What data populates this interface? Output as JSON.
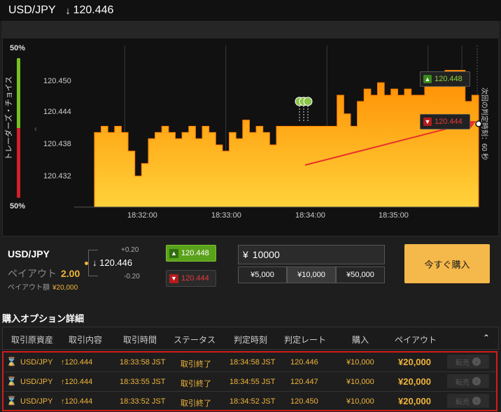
{
  "header": {
    "pair": "USD/JPY",
    "direction_icon": "↓",
    "price": "120.446"
  },
  "gauge": {
    "top_label": "50%",
    "bottom_label": "50%",
    "caption": "トレーダーズ・チョイス",
    "up_fraction": 0.5,
    "up_color": "#74c020",
    "down_color": "#d0202a"
  },
  "chart": {
    "y_ticks": [
      "120.450",
      "120.444",
      "120.438",
      "120.432"
    ],
    "x_ticks": [
      "18:32:00",
      "18:33:00",
      "18:34:00",
      "18:35:00"
    ],
    "up_price": "120.448",
    "down_price": "120.444",
    "side_label": "次回の判定時刻：60 秒"
  },
  "chart_data": {
    "type": "area",
    "ylim": [
      120.428,
      120.454
    ],
    "xlim": [
      "18:31:30",
      "18:35:30"
    ],
    "y_ticks": [
      120.45,
      120.444,
      120.438,
      120.432
    ],
    "x_ticks": [
      "18:32:00",
      "18:33:00",
      "18:34:00",
      "18:35:00"
    ],
    "x_seconds_from_start": [
      0,
      4,
      8,
      12,
      16,
      20,
      24,
      28,
      32,
      36,
      40,
      44,
      48,
      52,
      56,
      60,
      64,
      68,
      72,
      76,
      80,
      84,
      88,
      92,
      96,
      100,
      104,
      108,
      112,
      116,
      120,
      124,
      128,
      132,
      136,
      140,
      144,
      148,
      152,
      156,
      160,
      164,
      168,
      172,
      176,
      180,
      184,
      188,
      192,
      196,
      200,
      204,
      208,
      212,
      216,
      220,
      224,
      228
    ],
    "values": [
      120.44,
      120.441,
      120.44,
      120.441,
      120.44,
      120.437,
      120.433,
      120.435,
      120.439,
      120.44,
      120.441,
      120.44,
      120.439,
      120.44,
      120.441,
      120.439,
      120.441,
      120.44,
      120.438,
      120.437,
      120.44,
      120.439,
      120.442,
      120.44,
      120.441,
      120.44,
      120.438,
      120.441,
      120.441,
      120.441,
      120.441,
      120.441,
      120.441,
      120.441,
      120.441,
      120.441,
      120.446,
      120.443,
      120.441,
      120.445,
      120.447,
      120.446,
      120.448,
      120.446,
      120.447,
      120.446,
      120.447,
      120.446,
      120.446,
      120.448,
      120.448,
      120.448,
      120.45,
      120.45,
      120.45,
      120.445,
      120.446,
      120.446
    ],
    "series_color": "#ff9a00",
    "grid": true,
    "annotations": [
      "trend-arrow",
      "marker-pins"
    ]
  },
  "panel": {
    "pair": "USD/JPY",
    "payout_label": "ペイアウト",
    "payout_mult": "2.00",
    "payout_amount_label": "ペイアウト額",
    "payout_amount": "¥20,000",
    "plus": "+0.20",
    "minus": "-0.20",
    "current": "120.446",
    "up_price": "120.448",
    "down_price": "120.444",
    "amount_symbol": "¥",
    "amount_value": "10000",
    "chips": [
      "¥5,000",
      "¥10,000",
      "¥50,000"
    ],
    "buy_label": "今すぐ購入"
  },
  "details": {
    "title": "購入オプション詳細",
    "columns": [
      "取引原資産",
      "取引内容",
      "取引時間",
      "ステータス",
      "判定時刻",
      "判定レート",
      "購入",
      "ペイアウト"
    ],
    "rows": [
      {
        "pair": "USD/JPY",
        "content": "120.444",
        "time": "18:33:58 JST",
        "status": "取引終了",
        "judge_time": "18:34:58 JST",
        "rate": "120.446",
        "buy": "¥10,000",
        "payout": "¥20,000",
        "resell": "転売"
      },
      {
        "pair": "USD/JPY",
        "content": "120.444",
        "time": "18:33:55 JST",
        "status": "取引終了",
        "judge_time": "18:34:55 JST",
        "rate": "120.447",
        "buy": "¥10,000",
        "payout": "¥20,000",
        "resell": "転売"
      },
      {
        "pair": "USD/JPY",
        "content": "120.444",
        "time": "18:33:52 JST",
        "status": "取引終了",
        "judge_time": "18:34:52 JST",
        "rate": "120.450",
        "buy": "¥10,000",
        "payout": "¥20,000",
        "resell": "転売"
      }
    ]
  }
}
